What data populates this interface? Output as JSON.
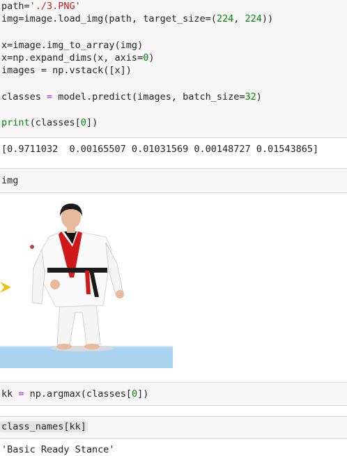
{
  "cell1": {
    "line1": {
      "a": "path=",
      "b": "'./3.PNG'"
    },
    "line2": {
      "a": "img=image.load_img(path, target_size=(",
      "n1": "224",
      "c": ", ",
      "n2": "224",
      "d": "))"
    },
    "line3": {
      "a": "x=image.img_to_array(img)"
    },
    "line4": {
      "a": "x=np.expand_dims(x, axis=",
      "n": "0",
      "b": ")"
    },
    "line5": {
      "a": "images = np.vstack([x])"
    },
    "line6": {
      "a": "classes ",
      "op": "=",
      "b": " model.predict(images, batch_size=",
      "n": "32",
      "c": ")"
    },
    "line7": {
      "kw": "print",
      "a": "(classes[",
      "n": "0",
      "b": "])"
    }
  },
  "output1": "[0.9711032  0.00165507 0.01031569 0.00148727 0.01543865]",
  "cell2": {
    "code": "img"
  },
  "figure": {
    "description_colors": {
      "uniform": "#ffffff",
      "belt": "#1a1a1a",
      "collar": "#d01818",
      "floor": "#a8d4f0",
      "arrow": "#f2c20a"
    }
  },
  "cell3": {
    "a": "kk ",
    "op": "=",
    "b": " np.argmax(classes[",
    "n": "0",
    "c": "])"
  },
  "cell4": {
    "code": "class_names[kk]"
  },
  "output4": "'Basic Ready Stance'"
}
